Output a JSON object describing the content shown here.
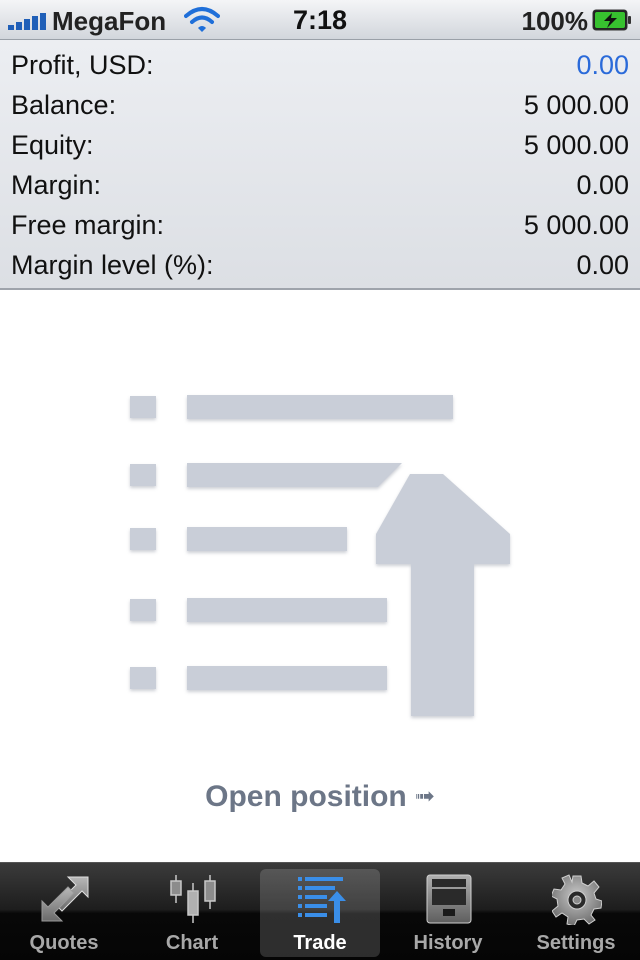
{
  "status_bar": {
    "carrier": "MegaFon",
    "time": "7:18",
    "battery": "100%"
  },
  "account": {
    "rows": [
      {
        "label": "Profit, USD:",
        "value": "0.00"
      },
      {
        "label": "Balance:",
        "value": "5 000.00"
      },
      {
        "label": "Equity:",
        "value": "5 000.00"
      },
      {
        "label": "Margin:",
        "value": "0.00"
      },
      {
        "label": "Free margin:",
        "value": "5 000.00"
      },
      {
        "label": "Margin level (%):",
        "value": "0.00"
      }
    ]
  },
  "empty_state": {
    "action_label": "Open position",
    "action_arrow": "➟"
  },
  "tabs": [
    {
      "label": "Quotes",
      "icon": "quotes-icon"
    },
    {
      "label": "Chart",
      "icon": "candlestick-chart-icon"
    },
    {
      "label": "Trade",
      "icon": "trade-list-icon",
      "active": true
    },
    {
      "label": "History",
      "icon": "archive-box-icon"
    },
    {
      "label": "Settings",
      "icon": "gear-icon"
    }
  ],
  "colors": {
    "profit_value": "#2a6ad9",
    "illustration": "#c9ced8",
    "action_text": "#6c7687",
    "tab_active_accent": "#3a8ee8"
  }
}
